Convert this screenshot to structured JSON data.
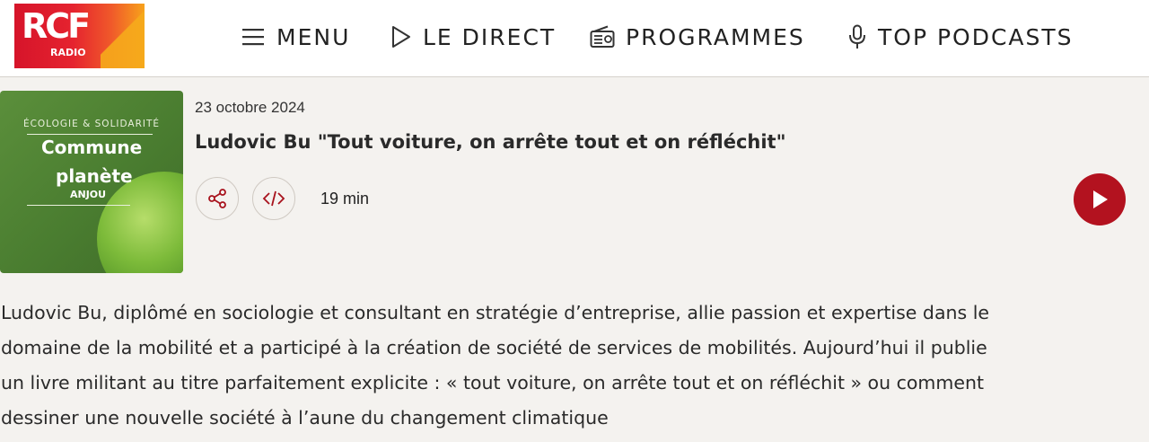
{
  "brand": {
    "logo_main": "RCF",
    "logo_sub": "RADIO",
    "colors": {
      "accent": "#b3121f",
      "logo_red": "#e5232f",
      "logo_orange": "#f7a21b"
    }
  },
  "nav": {
    "menu": {
      "label": "MENU",
      "icon": "hamburger-icon"
    },
    "live": {
      "label": "LE DIRECT",
      "icon": "play-outline-icon"
    },
    "programs": {
      "label": "PROGRAMMES",
      "icon": "radio-icon"
    },
    "podcasts": {
      "label": "TOP PODCASTS",
      "icon": "microphone-icon"
    }
  },
  "cover": {
    "category": "ÉCOLOGIE & SOLIDARITÉ",
    "title_line1": "Commune",
    "title_line2": "planète",
    "subtitle": "ANJOU"
  },
  "episode": {
    "date": "23 octobre 2024",
    "title": "Ludovic Bu \"Tout voiture, on arrête tout et on réfléchit\"",
    "duration": "19 min",
    "actions": {
      "share_icon": "share-icon",
      "embed_icon": "code-icon",
      "play_icon": "play-icon"
    }
  },
  "description": {
    "lines": [
      "Ludovic Bu, diplômé en sociologie et consultant en stratégie d’entreprise, allie passion et expertise dans le",
      "domaine de la mobilité et a participé à la création de société de services de mobilités. Aujourd’hui il publie",
      "un livre militant au titre parfaitement explicite : « tout voiture, on arrête tout et on réfléchit » ou comment",
      "dessiner une nouvelle société à l’aune du changement climatique"
    ]
  }
}
